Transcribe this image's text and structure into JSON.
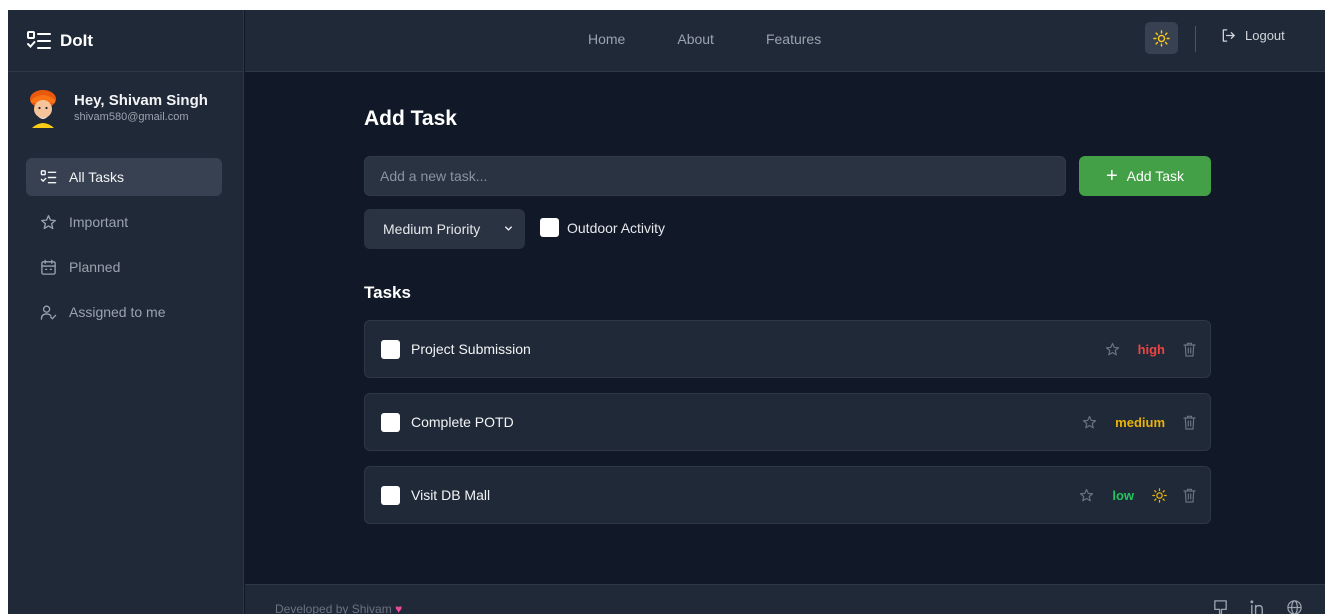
{
  "brand": {
    "name": "DoIt"
  },
  "user": {
    "greeting": "Hey, Shivam Singh",
    "email": "shivam580@gmail.com"
  },
  "sidebar": {
    "items": [
      {
        "label": "All Tasks",
        "icon": "task-list-icon",
        "active": true
      },
      {
        "label": "Important",
        "icon": "star-icon",
        "active": false
      },
      {
        "label": "Planned",
        "icon": "calendar-icon",
        "active": false
      },
      {
        "label": "Assigned to me",
        "icon": "user-check-icon",
        "active": false
      }
    ]
  },
  "header": {
    "nav": [
      "Home",
      "About",
      "Features"
    ],
    "theme_icon": "sun-icon",
    "logout_label": "Logout"
  },
  "add_task": {
    "title": "Add Task",
    "input_placeholder": "Add a new task...",
    "input_value": "",
    "button_label": "Add Task",
    "priority_selected": "Medium Priority",
    "outdoor_label": "Outdoor Activity",
    "outdoor_checked": false
  },
  "tasks": {
    "title": "Tasks",
    "items": [
      {
        "title": "Project Submission",
        "priority": "high",
        "priority_color": "#ef4444",
        "outdoor": false,
        "done": false
      },
      {
        "title": "Complete POTD",
        "priority": "medium",
        "priority_color": "#eab308",
        "outdoor": false,
        "done": false
      },
      {
        "title": "Visit DB Mall",
        "priority": "low",
        "priority_color": "#22c55e",
        "outdoor": true,
        "done": false
      }
    ]
  },
  "footer": {
    "text": "Developed by Shivam",
    "heart": "♥",
    "icons": [
      "github-icon",
      "linkedin-icon",
      "globe-icon"
    ]
  },
  "colors": {
    "background": "#111827",
    "panel": "#1f2937",
    "accent_green": "#43a047",
    "sun_yellow": "#facc15"
  }
}
